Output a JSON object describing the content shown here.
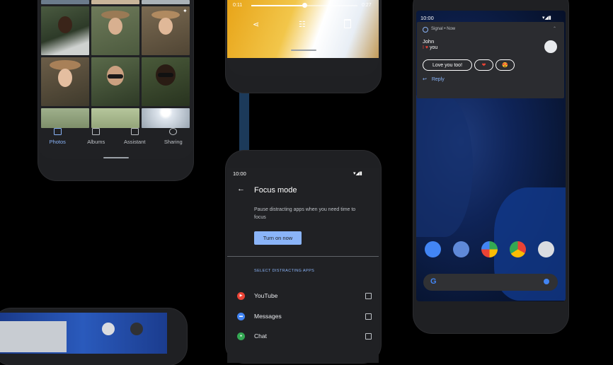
{
  "photos_app": {
    "tabs": [
      {
        "label": "Photos",
        "icon": "photo-icon",
        "active": true
      },
      {
        "label": "Albums",
        "icon": "albums-icon",
        "active": false
      },
      {
        "label": "Assistant",
        "icon": "assistant-icon",
        "active": false
      },
      {
        "label": "Sharing",
        "icon": "sharing-icon",
        "active": false
      }
    ]
  },
  "video_player": {
    "elapsed": "0:11",
    "duration": "0:27",
    "progress": 0.5,
    "actions": [
      "share-icon",
      "adjust-icon",
      "delete-icon"
    ]
  },
  "focus_mode": {
    "status_time": "10:00",
    "title": "Focus mode",
    "description": "Pause distracting apps when you need time to focus",
    "button_label": "Turn on now",
    "section_header": "SELECT DISTRACTING APPS",
    "apps": [
      {
        "name": "YouTube",
        "color": "#ea4335",
        "checked": false
      },
      {
        "name": "Messages",
        "color": "#4285f4",
        "checked": false
      },
      {
        "name": "Chat",
        "color": "#34a853",
        "checked": false
      }
    ]
  },
  "notification_phone": {
    "status_time": "10:00",
    "notification": {
      "app_name": "Signal",
      "time": "Now",
      "app_time_line": "Signal • Now",
      "sender": "John",
      "message_suffix": "you",
      "smart_replies": [
        "Love you too!",
        "❤",
        "😍"
      ],
      "reply_label": "Reply"
    },
    "dock_apps": [
      "phone-icon",
      "messages-icon",
      "play-store-icon",
      "chrome-icon",
      "camera-icon"
    ],
    "search_logo": "G",
    "colors": {
      "accent": "#8ab4f8",
      "wallpaper": "#0b1e4a"
    }
  }
}
